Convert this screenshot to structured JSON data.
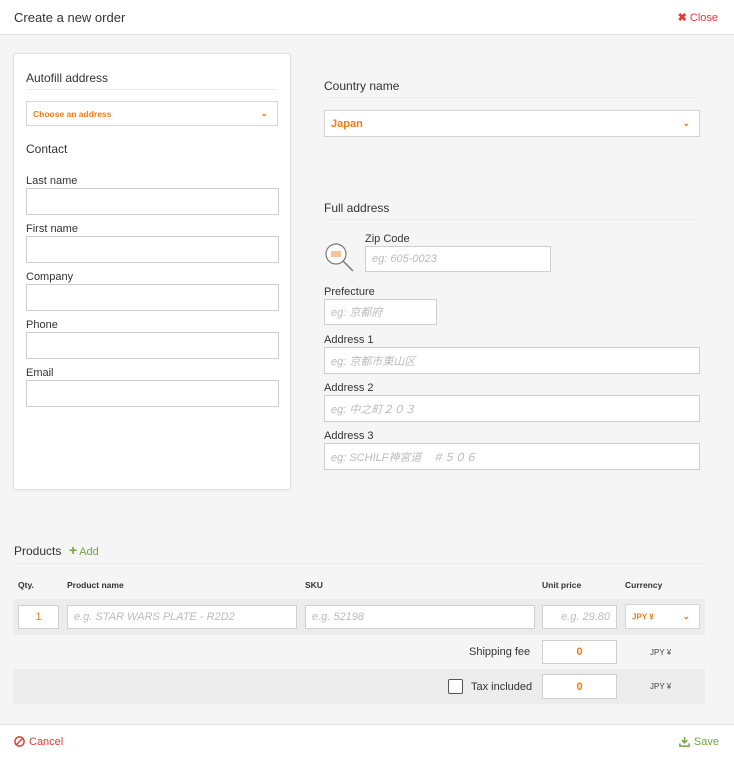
{
  "header": {
    "title": "Create a new order",
    "close_label": "Close"
  },
  "autofill": {
    "title": "Autofill address",
    "select_value": "Choose an address"
  },
  "contact": {
    "title": "Contact",
    "fields": [
      {
        "label": "Last name",
        "value": ""
      },
      {
        "label": "First name",
        "value": ""
      },
      {
        "label": "Company",
        "value": ""
      },
      {
        "label": "Phone",
        "value": ""
      },
      {
        "label": "Email",
        "value": ""
      }
    ]
  },
  "country": {
    "title": "Country name",
    "value": "Japan"
  },
  "address": {
    "title": "Full address",
    "zip": {
      "label": "Zip Code",
      "placeholder": "eg: 605-0023"
    },
    "prefecture": {
      "label": "Prefecture",
      "placeholder": "eg: 京都府"
    },
    "address1": {
      "label": "Address 1",
      "placeholder": "eg: 京都市東山区"
    },
    "address2": {
      "label": "Address 2",
      "placeholder": "eg: 中之町２０３"
    },
    "address3": {
      "label": "Address 3",
      "placeholder": "eg: SCHILF神宮道　＃５０６"
    }
  },
  "products": {
    "title": "Products",
    "add_label": "Add",
    "columns": {
      "qty": "Qty.",
      "name": "Product name",
      "sku": "SKU",
      "unit_price": "Unit price",
      "currency": "Currency"
    },
    "row": {
      "qty": "1",
      "name_placeholder": "e.g. STAR WARS PLATE - R2D2",
      "sku_placeholder": "e.g. 52198",
      "price_placeholder": "e.g. 29.80",
      "currency": "JPY ¥"
    },
    "shipping": {
      "label": "Shipping fee",
      "value": "0",
      "currency": "JPY ¥"
    },
    "tax": {
      "label": "Tax included",
      "value": "0",
      "currency": "JPY ¥"
    }
  },
  "footer": {
    "cancel_label": "Cancel",
    "save_label": "Save"
  },
  "colors": {
    "accent": "#f07c1b",
    "danger": "#e53935",
    "success": "#6fa63b"
  }
}
